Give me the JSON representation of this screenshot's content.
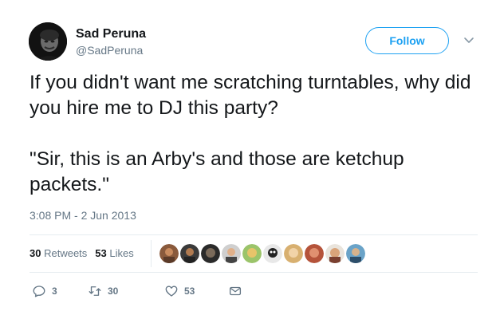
{
  "author": {
    "name": "Sad Peruna",
    "handle": "@SadPeruna"
  },
  "follow_label": "Follow",
  "tweet": {
    "line1": "If you didn't want me scratching turntables, why did you hire me to DJ this party?",
    "line2": "\"Sir, this is an Arby's and those are ketchup packets.\""
  },
  "timestamp": "3:08 PM - 2 Jun 2013",
  "stats": {
    "retweets_count": "30",
    "retweets_label": "Retweets",
    "likes_count": "53",
    "likes_label": "Likes"
  },
  "liker_avatars": [
    "avatar-1",
    "avatar-2",
    "avatar-3",
    "avatar-4",
    "avatar-5",
    "avatar-6",
    "avatar-7",
    "avatar-8",
    "avatar-9",
    "avatar-10"
  ],
  "actions": {
    "replies": "3",
    "retweets": "30",
    "likes": "53"
  },
  "colors": {
    "accent": "#1da1f2",
    "muted": "#657786",
    "text": "#14171a",
    "divider": "#e6ecf0"
  }
}
